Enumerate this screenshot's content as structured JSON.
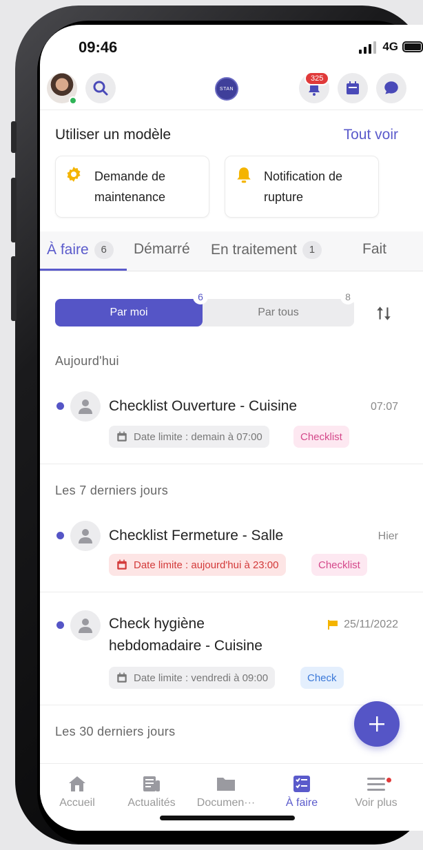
{
  "status_bar": {
    "time": "09:46",
    "network": "4G"
  },
  "header": {
    "logo_text": "STAN",
    "notification_count": "325"
  },
  "templates": {
    "title": "Utiliser un modèle",
    "see_all": "Tout voir",
    "cards": [
      {
        "line1": "Demande de",
        "line2": "maintenance",
        "icon": "gear-icon",
        "color": "#f4b400"
      },
      {
        "line1": "Notification de",
        "line2": "rupture",
        "icon": "bell-icon",
        "color": "#f4b400"
      }
    ]
  },
  "tabs": [
    {
      "label": "À faire",
      "count": "6",
      "active": true
    },
    {
      "label": "Démarré"
    },
    {
      "label": "En traitement",
      "count": "1"
    },
    {
      "label": "Fait"
    }
  ],
  "segmented": {
    "mine_label": "Par moi",
    "mine_count": "6",
    "all_label": "Par tous",
    "all_count": "8"
  },
  "sections": {
    "today": "Aujourd'hui",
    "last7": "Les 7 derniers jours",
    "last30": "Les 30 derniers jours"
  },
  "tasks": [
    {
      "title": "Checklist Ouverture - Cuisine",
      "time": "07:07",
      "deadline": "Date limite : demain à 07:00",
      "type": "Checklist"
    },
    {
      "title": "Checklist Fermeture - Salle",
      "time": "Hier",
      "deadline": "Date limite : aujourd'hui à 23:00",
      "type": "Checklist"
    },
    {
      "title_line1": "Check hygiène",
      "title_line2": "hebdomadaire - Cuisine",
      "time": "25/11/2022",
      "deadline": "Date limite : vendredi à 09:00",
      "type": "Check"
    }
  ],
  "bottom_nav": [
    {
      "label": "Accueil",
      "icon": "home-icon"
    },
    {
      "label": "Actualités",
      "icon": "news-icon"
    },
    {
      "label": "Documen···",
      "icon": "folder-icon"
    },
    {
      "label": "À faire",
      "icon": "checklist-icon",
      "active": true
    },
    {
      "label": "Voir plus",
      "icon": "menu-icon"
    }
  ],
  "colors": {
    "accent": "#5555c6",
    "danger": "#d33a3a",
    "warning": "#f4b400"
  }
}
